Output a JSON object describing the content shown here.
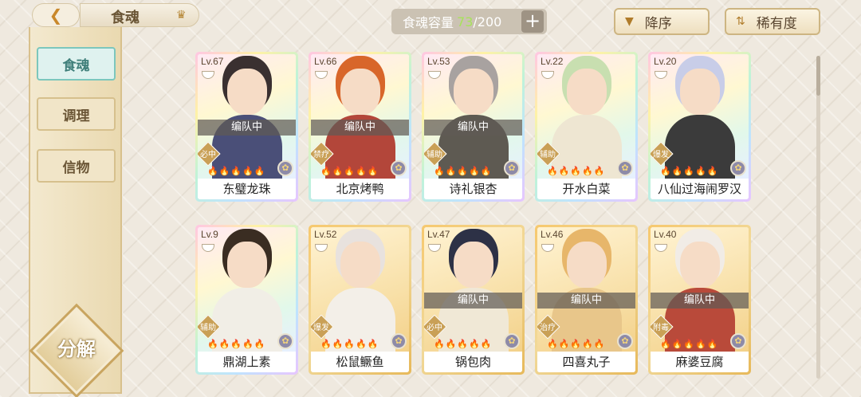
{
  "header": {
    "back_glyph": "❮",
    "title": "食魂",
    "crown_icon": "crown-icon",
    "capacity_label": "食魂容量",
    "capacity_current": "73",
    "capacity_max": "/200",
    "add_glyph": "+",
    "sort_order_label": "降序",
    "sort_key_label": "稀有度"
  },
  "sidebar": {
    "items": [
      {
        "label": "食魂",
        "active": true
      },
      {
        "label": "调理",
        "active": false
      },
      {
        "label": "信物",
        "active": false
      }
    ],
    "decompose_label": "分解"
  },
  "cards": [
    {
      "level": "Lv.67",
      "name": "东璧龙珠",
      "team": "编队中",
      "role": "必中",
      "rarity": "ssr",
      "cloth": "#4a4f78",
      "hair": "#3a3030",
      "flames": "🔥🔥🔥🔥🔥"
    },
    {
      "level": "Lv.66",
      "name": "北京烤鸭",
      "team": "编队中",
      "role": "禁疗",
      "rarity": "ssr",
      "cloth": "#b3463a",
      "hair": "#d8662a",
      "flames": "🔥🔥🔥🔥🔥"
    },
    {
      "level": "Lv.53",
      "name": "诗礼银杏",
      "team": "编队中",
      "role": "辅助",
      "rarity": "ssr",
      "cloth": "#5e5a52",
      "hair": "#a8a2a0",
      "flames": "🔥🔥🔥🔥🔥"
    },
    {
      "level": "Lv.22",
      "name": "开水白菜",
      "team": "",
      "role": "辅助",
      "rarity": "ssr",
      "cloth": "#eee6d2",
      "hair": "#c8dfb0",
      "flames": "🔥🔥🔥🔥🔥"
    },
    {
      "level": "Lv.20",
      "name": "八仙过海闹罗汉",
      "team": "",
      "role": "爆发",
      "rarity": "ssr",
      "cloth": "#3b3b3b",
      "hair": "#c8cde8",
      "flames": "🔥🔥🔥🔥🔥"
    },
    {
      "level": "Lv.9",
      "name": "鼎湖上素",
      "team": "",
      "role": "辅助",
      "rarity": "ssr",
      "cloth": "#f1eee6",
      "hair": "#3a2d22",
      "flames": "🔥🔥🔥🔥🔥"
    },
    {
      "level": "Lv.52",
      "name": "松鼠鳜鱼",
      "team": "",
      "role": "爆发",
      "rarity": "sr",
      "cloth": "#f3efe8",
      "hair": "#e8e2de",
      "flames": "🔥🔥🔥🔥🔥"
    },
    {
      "level": "Lv.47",
      "name": "锅包肉",
      "team": "编队中",
      "role": "必中",
      "rarity": "sr",
      "cloth": "#f0e8d6",
      "hair": "#2d3146",
      "flames": "🔥🔥🔥🔥🔥"
    },
    {
      "level": "Lv.46",
      "name": "四喜丸子",
      "team": "编队中",
      "role": "治疗",
      "rarity": "sr",
      "cloth": "#e8c68a",
      "hair": "#e7b66a",
      "flames": "🔥🔥🔥🔥🔥"
    },
    {
      "level": "Lv.40",
      "name": "麻婆豆腐",
      "team": "编队中",
      "role": "附毒",
      "rarity": "sr",
      "cloth": "#b94a3a",
      "hair": "#f1ece6",
      "flames": "🔥🔥🔥🔥🔥"
    }
  ]
}
